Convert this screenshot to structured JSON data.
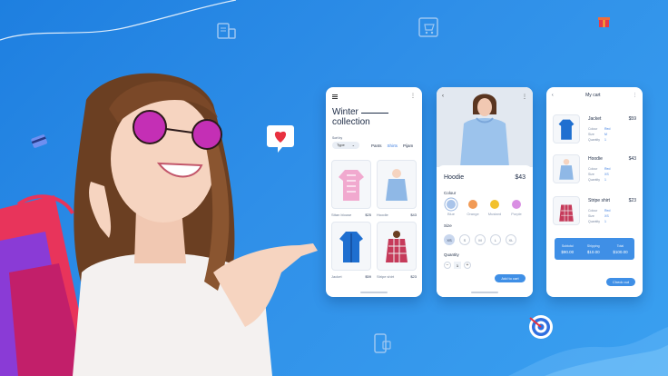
{
  "colors": {
    "background": "#2a8ae6",
    "accent": "#3f8fe6",
    "swatch_blue": "#a9c4ea",
    "swatch_orange": "#f19a55",
    "swatch_mustard": "#f2c12e",
    "swatch_purple": "#d98fe3"
  },
  "phone_list": {
    "title_line1": "Winter",
    "title_line2": "collection",
    "sort_by": "Sort by",
    "type_select": "Type",
    "categories": [
      "Pants",
      "Shirts",
      "Pijam"
    ],
    "products": [
      {
        "name": "Sttan blouse",
        "price": "$25",
        "icon": "pink-blouse"
      },
      {
        "name": "Hoodie",
        "price": "$43",
        "icon": "blue-hoodie"
      },
      {
        "name": "Jacket",
        "price": "$59",
        "icon": "blue-jacket"
      },
      {
        "name": "Stripe shirt",
        "price": "$23",
        "icon": "plaid-shirt"
      }
    ]
  },
  "phone_detail": {
    "product_name": "Hoodie",
    "price": "$43",
    "colour_label": "Colour",
    "colours": [
      "Blue",
      "Orange",
      "Mustard",
      "Purple"
    ],
    "size_label": "Size",
    "sizes": [
      "XS",
      "S",
      "M",
      "L",
      "XL"
    ],
    "selected_size": "XS",
    "quantity_label": "Quantity",
    "quantity": "1",
    "minus": "−",
    "plus": "+",
    "add_to_cart": "Add to cart"
  },
  "phone_cart": {
    "title": "My cart",
    "items": [
      {
        "name": "Jacket",
        "price": "$59",
        "colour": "Red",
        "size": "M",
        "quantity": "1",
        "icon": "blue-jacket"
      },
      {
        "name": "Hoodie",
        "price": "$43",
        "colour": "Red",
        "size": "XS",
        "quantity": "1",
        "icon": "blue-hoodie"
      },
      {
        "name": "Stripe shirt",
        "price": "$23",
        "colour": "Red",
        "size": "XS",
        "quantity": "1",
        "icon": "plaid-shirt"
      }
    ],
    "attr_labels": {
      "colour": "Colour",
      "size": "Size",
      "quantity": "Quantity"
    },
    "summary": {
      "subtotal_label": "Subtotal",
      "subtotal": "$90.00",
      "shipping_label": "Shipping",
      "shipping": "$10.00",
      "total_label": "Total",
      "total": "$100.00"
    },
    "checkout": "Check out"
  }
}
